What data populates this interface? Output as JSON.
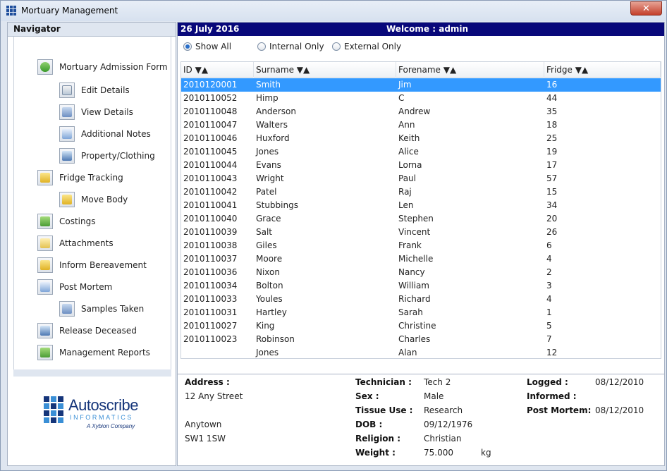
{
  "window": {
    "title": "Mortuary Management",
    "close_glyph": "✕"
  },
  "navigator": {
    "title": "Navigator",
    "items": [
      {
        "label": "Mortuary Admission Form",
        "icon": "admission-icon"
      },
      {
        "label": "Edit Details",
        "icon": "edit-icon"
      },
      {
        "label": "View Details",
        "icon": "view-icon"
      },
      {
        "label": "Additional Notes",
        "icon": "notes-icon"
      },
      {
        "label": "Property/Clothing",
        "icon": "property-icon"
      },
      {
        "label": "Fridge Tracking",
        "icon": "fridge-icon"
      },
      {
        "label": "Move Body",
        "icon": "move-icon"
      },
      {
        "label": "Costings",
        "icon": "costings-icon"
      },
      {
        "label": "Attachments",
        "icon": "attachments-icon"
      },
      {
        "label": "Inform Bereavement",
        "icon": "inform-icon"
      },
      {
        "label": "Post Mortem",
        "icon": "post-mortem-icon"
      },
      {
        "label": "Samples Taken",
        "icon": "samples-icon"
      },
      {
        "label": "Release Deceased",
        "icon": "release-icon"
      },
      {
        "label": "Management Reports",
        "icon": "reports-icon"
      }
    ]
  },
  "logo": {
    "name": "Autoscribe",
    "sub": "INFORMATICS",
    "tag": "A Xybion Company"
  },
  "header": {
    "date": "26 July 2016",
    "welcome": "Welcome : admin"
  },
  "filters": {
    "options": [
      "Show All",
      "Internal Only",
      "External Only"
    ],
    "selected": "Show All"
  },
  "table": {
    "columns": [
      "ID ▼▲",
      "Surname ▼▲",
      "Forename ▼▲",
      "Fridge ▼▲"
    ],
    "selected_index": 0,
    "rows": [
      [
        "2010120001",
        "Smith",
        "Jim",
        "16"
      ],
      [
        "2010110052",
        "Himp",
        "C",
        "44"
      ],
      [
        "2010110048",
        "Anderson",
        "Andrew",
        "35"
      ],
      [
        "2010110047",
        "Walters",
        "Ann",
        "18"
      ],
      [
        "2010110046",
        "Huxford",
        "Keith",
        "25"
      ],
      [
        "2010110045",
        "Jones",
        "Alice",
        "19"
      ],
      [
        "2010110044",
        "Evans",
        "Lorna",
        "17"
      ],
      [
        "2010110043",
        "Wright",
        "Paul",
        "57"
      ],
      [
        "2010110042",
        "Patel",
        "Raj",
        "15"
      ],
      [
        "2010110041",
        "Stubbings",
        "Len",
        "34"
      ],
      [
        "2010110040",
        "Grace",
        "Stephen",
        "20"
      ],
      [
        "2010110039",
        "Salt",
        "Vincent",
        "26"
      ],
      [
        "2010110038",
        "Giles",
        "Frank",
        "6"
      ],
      [
        "2010110037",
        "Moore",
        "Michelle",
        "4"
      ],
      [
        "2010110036",
        "Nixon",
        "Nancy",
        "2"
      ],
      [
        "2010110034",
        "Bolton",
        "William",
        "3"
      ],
      [
        "2010110033",
        "Youles",
        "Richard",
        "4"
      ],
      [
        "2010110031",
        "Hartley",
        "Sarah",
        "1"
      ],
      [
        "2010110027",
        "King",
        "Christine",
        "5"
      ],
      [
        "2010110023",
        "Robinson",
        "Charles",
        "7"
      ],
      [
        "",
        "Jones",
        "Alan",
        "12"
      ]
    ]
  },
  "details": {
    "address_label": "Address :",
    "address_lines": [
      "12 Any Street",
      "",
      "",
      "Anytown",
      "SW1 1SW"
    ],
    "technician_label": "Technician :",
    "technician": "Tech 2",
    "sex_label": "Sex :",
    "sex": "Male",
    "tissue_label": "Tissue Use :",
    "tissue": "Research",
    "dob_label": "DOB :",
    "dob": "09/12/1976",
    "religion_label": "Religion :",
    "religion": "Christian",
    "weight_label": "Weight :",
    "weight": "75.000",
    "weight_unit": "kg",
    "logged_label": "Logged :",
    "logged": "08/12/2010",
    "informed_label": "Informed :",
    "informed": "",
    "pm_label": "Post Mortem:",
    "pm": "08/12/2010"
  },
  "colors": {
    "header_bar": "#08087a",
    "selection": "#3399ff"
  }
}
